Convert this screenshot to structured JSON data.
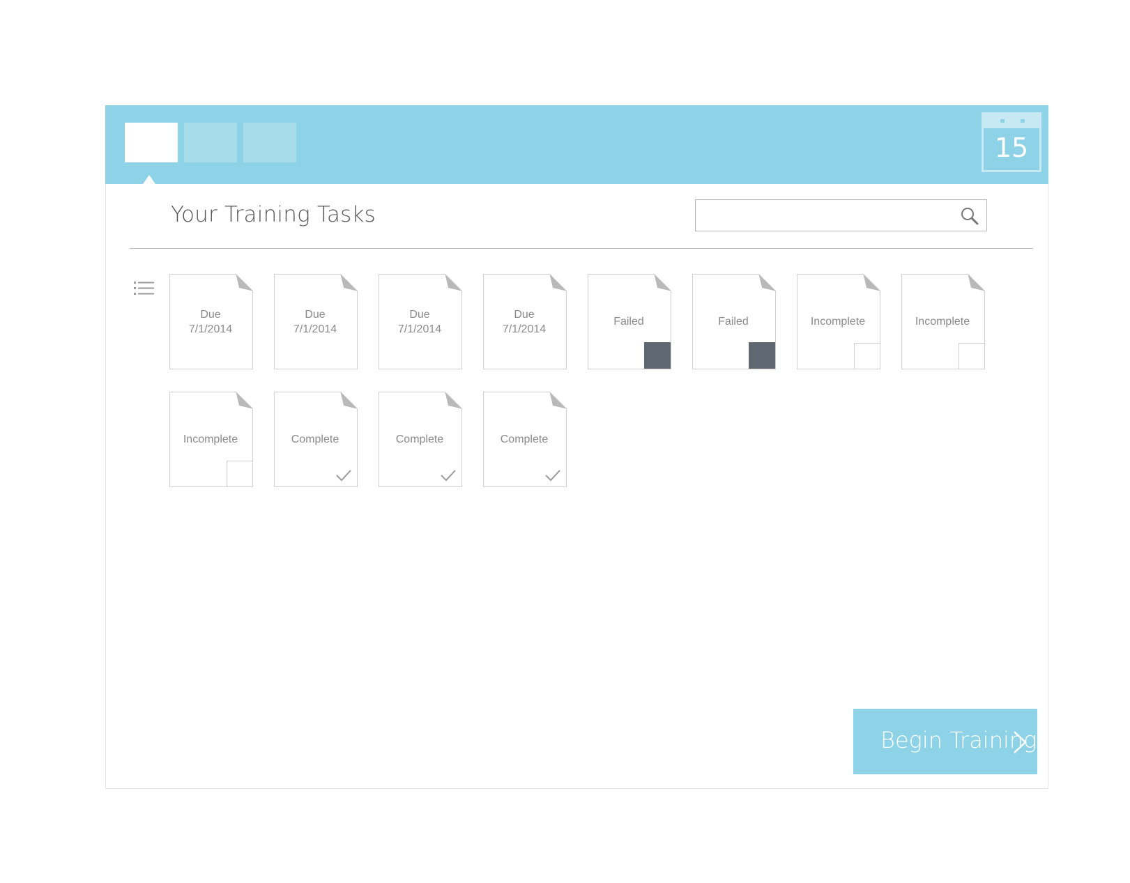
{
  "header": {
    "tabs": [
      {
        "state": "active"
      },
      {
        "state": "inactive"
      },
      {
        "state": "inactive"
      }
    ],
    "calendar": {
      "day": "15",
      "icon": "calendar-icon"
    }
  },
  "main": {
    "title": "Your Training Tasks",
    "search": {
      "value": "",
      "placeholder": "",
      "icon": "search-icon"
    },
    "view_icon": "list-icon",
    "tasks": [
      {
        "status": "due",
        "line1": "Due",
        "line2": "7/1/2014"
      },
      {
        "status": "due",
        "line1": "Due",
        "line2": "7/1/2014"
      },
      {
        "status": "due",
        "line1": "Due",
        "line2": "7/1/2014"
      },
      {
        "status": "due",
        "line1": "Due",
        "line2": "7/1/2014"
      },
      {
        "status": "failed",
        "line1": "Failed"
      },
      {
        "status": "failed",
        "line1": "Failed"
      },
      {
        "status": "incomplete",
        "line1": "Incomplete"
      },
      {
        "status": "incomplete",
        "line1": "Incomplete"
      },
      {
        "status": "incomplete",
        "line1": "Incomplete"
      },
      {
        "status": "complete",
        "line1": "Complete"
      },
      {
        "status": "complete",
        "line1": "Complete"
      },
      {
        "status": "complete",
        "line1": "Complete"
      }
    ],
    "begin_button": {
      "label": "Begin Training",
      "icon": "chevron-right-icon"
    }
  },
  "colors": {
    "accent": "#8dd2e6",
    "tab_inactive": "#a7dceb",
    "failed_marker": "#5f6870",
    "text": "#8a8a8a"
  }
}
